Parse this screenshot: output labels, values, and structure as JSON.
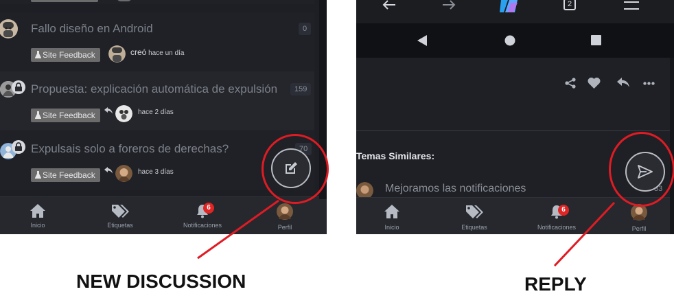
{
  "left": {
    "topics": [
      {
        "title": "",
        "count": ""
      },
      {
        "title": "Fallo diseño en Android",
        "count": "0",
        "tag": "Site Feedback",
        "meta_action": "creó",
        "meta_time": "hace un día"
      },
      {
        "title": "Propuesta: explicación automática de expulsión",
        "count": "159",
        "tag": "Site Feedback",
        "meta_time": "hace 2 días"
      },
      {
        "title": "Expulsais solo a foreros de derechas?",
        "count": "70",
        "tag": "Site Feedback",
        "meta_time": "hace 3 días"
      }
    ],
    "nav": [
      {
        "label": "Inicio",
        "icon": "home-icon"
      },
      {
        "label": "Etiquetas",
        "icon": "tags-icon"
      },
      {
        "label": "Notificaciones",
        "icon": "bell-icon",
        "badge": "6"
      },
      {
        "label": "Perfil",
        "icon": "avatar"
      }
    ],
    "fab_icon": "edit-icon"
  },
  "right": {
    "browser_toolbar": {
      "tab_count": "2",
      "icons": [
        "back-arrow-icon",
        "forward-arrow-icon",
        "copilot-icon",
        "tab-count-icon",
        "menu-icon"
      ]
    },
    "android_nav": [
      "back-triangle-icon",
      "home-circle-icon",
      "recents-square-icon"
    ],
    "post_actions": [
      "share-icon",
      "heart-icon",
      "reply-icon",
      "more-icon"
    ],
    "similar_heading": "Temas Similares:",
    "similar_topic": "Mejoramos las notificaciones",
    "similar_count": "33",
    "nav": [
      {
        "label": "Inicio",
        "icon": "home-icon"
      },
      {
        "label": "Etiquetas",
        "icon": "tags-icon"
      },
      {
        "label": "Notificaciones",
        "icon": "bell-icon",
        "badge": "6"
      },
      {
        "label": "Perfil",
        "icon": "avatar"
      }
    ],
    "fab_icon": "send-icon"
  },
  "captions": {
    "left": "NEW DISCUSSION",
    "right": "REPLY"
  },
  "colors": {
    "highlight": "#e01b24",
    "badge": "#e02525",
    "tag": "#6b6b6b",
    "background": "#1e1f24"
  }
}
